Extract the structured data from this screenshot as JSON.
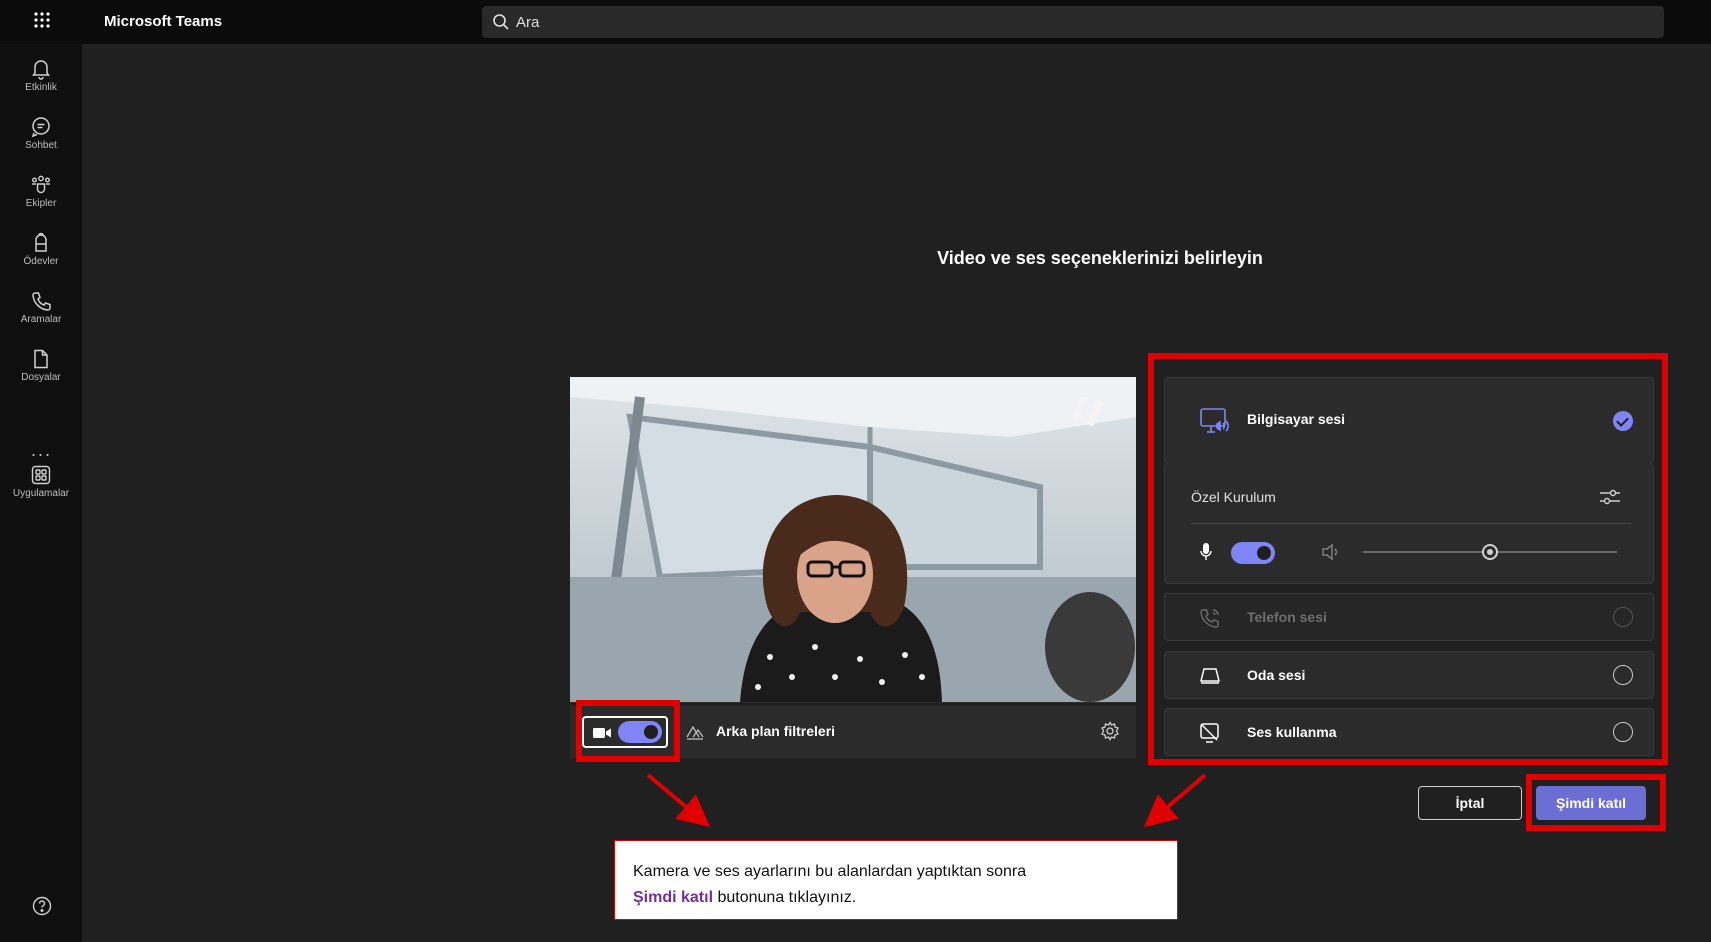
{
  "app": {
    "title": "Microsoft Teams"
  },
  "search": {
    "placeholder": "Ara"
  },
  "rail": {
    "items": [
      {
        "label": "Etkinlik",
        "icon": "bell-icon"
      },
      {
        "label": "Sohbet",
        "icon": "chat-icon"
      },
      {
        "label": "Ekipler",
        "icon": "teams-icon"
      },
      {
        "label": "Ödevler",
        "icon": "assignments-icon"
      },
      {
        "label": "Aramalar",
        "icon": "phone-icon"
      },
      {
        "label": "Dosyalar",
        "icon": "file-icon"
      },
      {
        "label": "Uygulamalar",
        "icon": "apps-icon"
      }
    ],
    "more": "···"
  },
  "prejoin": {
    "heading": "Video ve ses seçeneklerinizi belirleyin",
    "camera_on": true,
    "background_filters": "Arka plan filtreleri"
  },
  "audio": {
    "computer": {
      "label": "Bilgisayar sesi",
      "selected": true
    },
    "custom_setup": "Özel Kurulum",
    "mic_on": true,
    "volume_level": 0.5,
    "phone": {
      "label": "Telefon sesi",
      "disabled": true
    },
    "room": {
      "label": "Oda sesi"
    },
    "no_audio": {
      "label": "Ses kullanma"
    }
  },
  "actions": {
    "cancel": "İptal",
    "join": "Şimdi katıl"
  },
  "callout": {
    "line1": "Kamera ve ses ayarlarını bu alanlardan yaptıktan sonra",
    "highlight": "Şimdi katıl",
    "line2_rest": " butonuna tıklayınız."
  },
  "colors": {
    "accent": "#7f85f5",
    "annotation": "#e00000",
    "highlight_text": "#7030a0"
  }
}
